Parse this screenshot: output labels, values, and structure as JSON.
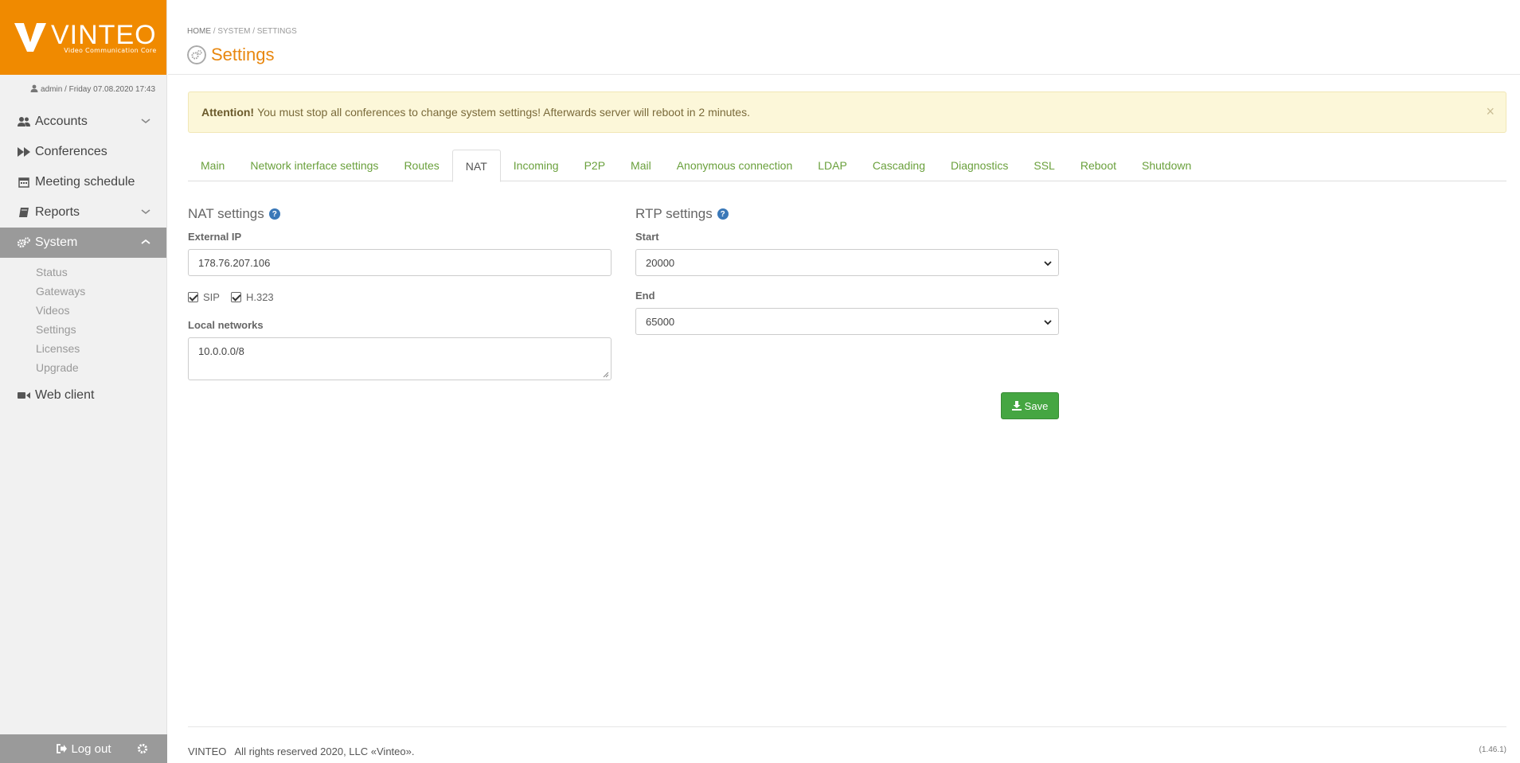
{
  "brand": {
    "name": "VINTEO",
    "tagline": "Video Communication Core",
    "color": "#f08a00"
  },
  "userline": "admin / Friday 07.08.2020 17:43",
  "nav": [
    {
      "label": "Accounts",
      "icon": "users-icon",
      "has_chevron": true
    },
    {
      "label": "Conferences",
      "icon": "fast-forward-icon"
    },
    {
      "label": "Meeting schedule",
      "icon": "calendar-icon"
    },
    {
      "label": "Reports",
      "icon": "book-icon",
      "has_chevron": true
    },
    {
      "label": "System",
      "icon": "gears-icon",
      "active": true
    },
    {
      "label": "Web client",
      "icon": "video-camera-icon"
    }
  ],
  "system_subnav": [
    "Status",
    "Gateways",
    "Videos",
    "Settings",
    "Licenses",
    "Upgrade"
  ],
  "logout_label": "Log out",
  "breadcrumb": {
    "home": "HOME",
    "system": "/ SYSTEM",
    "settings": "/ SETTINGS"
  },
  "page_title": "Settings",
  "alert": {
    "strong": "Attention!",
    "text": "You must stop all conferences to change system settings! Afterwards server will reboot in 2 minutes.",
    "close": "×"
  },
  "tabs": [
    "Main",
    "Network interface settings",
    "Routes",
    "NAT",
    "Incoming",
    "P2P",
    "Mail",
    "Anonymous connection",
    "LDAP",
    "Cascading",
    "Diagnostics",
    "SSL",
    "Reboot",
    "Shutdown"
  ],
  "active_tab": "NAT",
  "nat": {
    "title": "NAT settings",
    "external_ip_label": "External IP",
    "external_ip_value": "178.76.207.106",
    "sip_label": "SIP",
    "h323_label": "H.323",
    "sip_checked": true,
    "h323_checked": true,
    "local_networks_label": "Local networks",
    "local_networks_value": "10.0.0.0/8"
  },
  "rtp": {
    "title": "RTP settings",
    "start_label": "Start",
    "start_value": "20000",
    "end_label": "End",
    "end_value": "65000"
  },
  "save_label": "Save",
  "footer": {
    "left": "VINTEO   All rights reserved 2020, LLC «Vinteo».",
    "version": "(1.46.1)"
  },
  "colors": {
    "accent": "#e8870f",
    "link": "#6aa03c",
    "save": "#45a642",
    "help": "#3a78b8"
  }
}
